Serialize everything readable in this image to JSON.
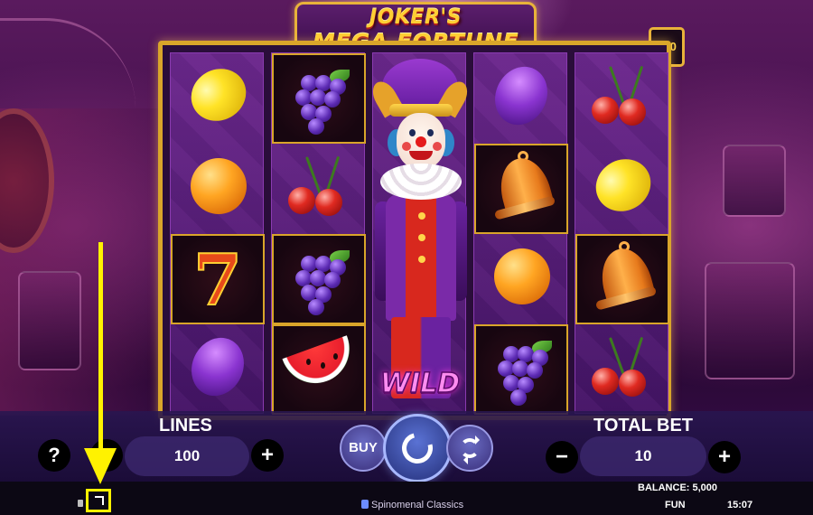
{
  "game": {
    "title_line1": "JOKER'S",
    "title_line2": "MEGA FORTUNE",
    "lines_badge": "100",
    "wild_label": "WILD"
  },
  "reels": [
    [
      "lemon",
      "orange",
      "seven",
      "plum"
    ],
    [
      "grapes",
      "cherries",
      "grapes",
      "watermelon"
    ],
    [
      "joker-wild"
    ],
    [
      "plum",
      "bell",
      "orange",
      "grapes"
    ],
    [
      "cherries",
      "lemon",
      "bell",
      "cherries"
    ]
  ],
  "controls": {
    "help_label": "?",
    "lines_label": "LINES",
    "lines_value": "100",
    "lines_minus": "−",
    "lines_plus": "+",
    "buy_label": "BUY",
    "total_bet_label": "TOTAL BET",
    "bet_value": "10",
    "bet_minus": "−",
    "bet_plus": "+"
  },
  "status": {
    "balance": "BALANCE: 5,000",
    "mode": "FUN",
    "time": "15:07",
    "brand": "Spinomenal Classics"
  },
  "annotation": {
    "color": "#fff200",
    "target": "fullscreen-button"
  }
}
